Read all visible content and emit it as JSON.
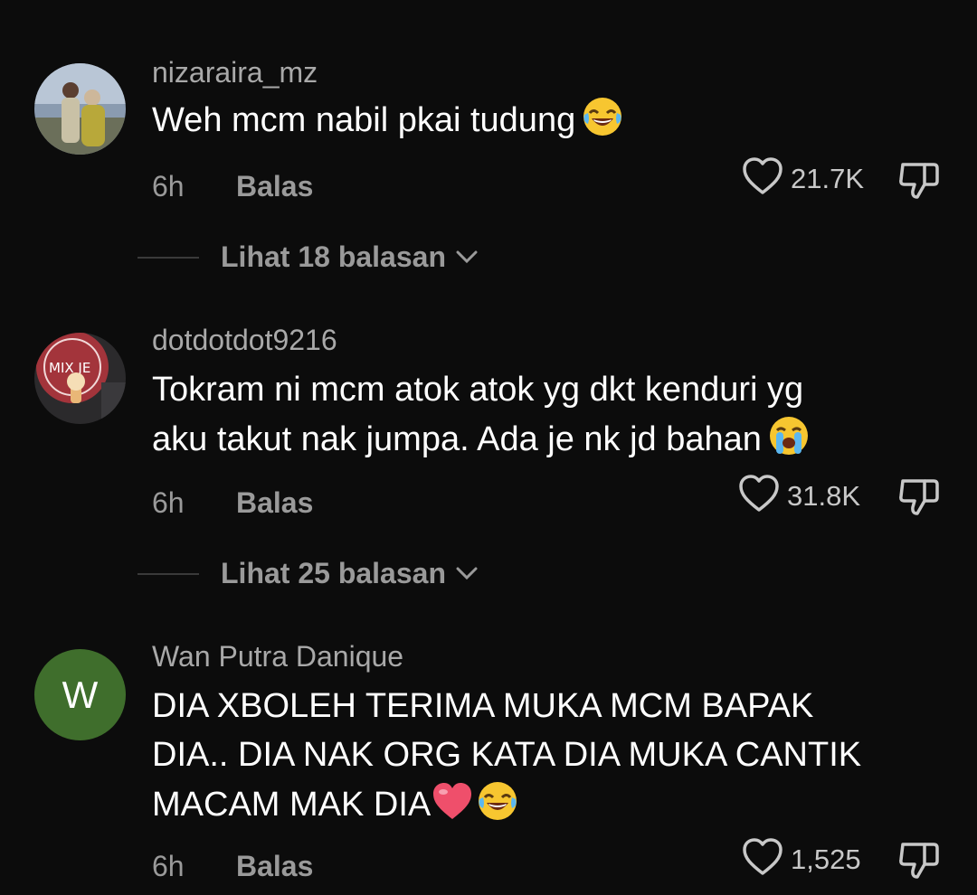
{
  "comments": [
    {
      "username": "nizaraira_mz",
      "text": "Weh mcm nabil pkai tudung",
      "emoji": "face-with-tears-of-joy",
      "time": "6h",
      "reply_label": "Balas",
      "likes": "21.7K",
      "replies_label": "Lihat 18 balasan"
    },
    {
      "username": "dotdotdot9216",
      "text_line1": "Tokram ni mcm atok atok yg dkt kenduri yg",
      "text_line2": "aku takut nak jumpa. Ada je nk jd bahan",
      "emoji": "loudly-crying-face",
      "avatar_text": "MIX JE",
      "time": "6h",
      "reply_label": "Balas",
      "likes": "31.8K",
      "replies_label": "Lihat 25 balasan"
    },
    {
      "username": "Wan Putra Danique",
      "avatar_letter": "W",
      "text_line1": "DIA XBOLEH TERIMA MUKA MCM BAPAK",
      "text_line2": "DIA.. DIA NAK ORG KATA DIA MUKA CANTIK",
      "text_line3": "MACAM MAK DIA",
      "emojis": [
        "red-heart",
        "face-with-tears-of-joy"
      ],
      "time": "6h",
      "reply_label": "Balas",
      "likes": "1,525"
    }
  ],
  "colors": {
    "background": "#0c0c0c",
    "username": "#a9a9a9",
    "secondary": "#9a9a9a",
    "avatar_w": "#3f6e2c"
  }
}
